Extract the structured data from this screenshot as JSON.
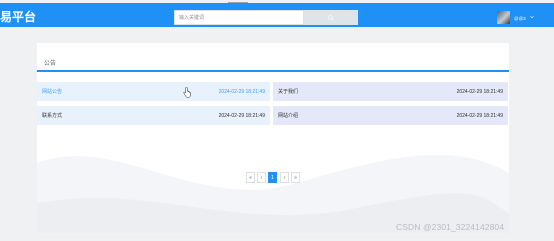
{
  "header": {
    "brand": "易平台",
    "search": {
      "placeholder": "输入关键词",
      "value": ""
    },
    "search_icon": "search-icon",
    "user": {
      "name": "@@3",
      "avatar_icon": "avatar-photo",
      "menu_icon": "chevron-down-icon"
    }
  },
  "main": {
    "section_title": "公告",
    "notices": [
      {
        "title": "网站公告",
        "date": "2024-02-29 18:21:49"
      },
      {
        "title": "关于我们",
        "date": "2024-02-29 18:21:49"
      },
      {
        "title": "联系方式",
        "date": "2024-02-29 18:21:49"
      },
      {
        "title": "网站介绍",
        "date": "2024-02-29 18:21:49"
      }
    ],
    "pagination": {
      "first": "«",
      "prev": "‹",
      "current": "1",
      "next": "›",
      "last": "»"
    }
  },
  "watermark": "CSDN @2301_3224142804",
  "colors": {
    "primary": "#1e90f6",
    "background": "#f0f1f3",
    "link": "#409eff"
  }
}
